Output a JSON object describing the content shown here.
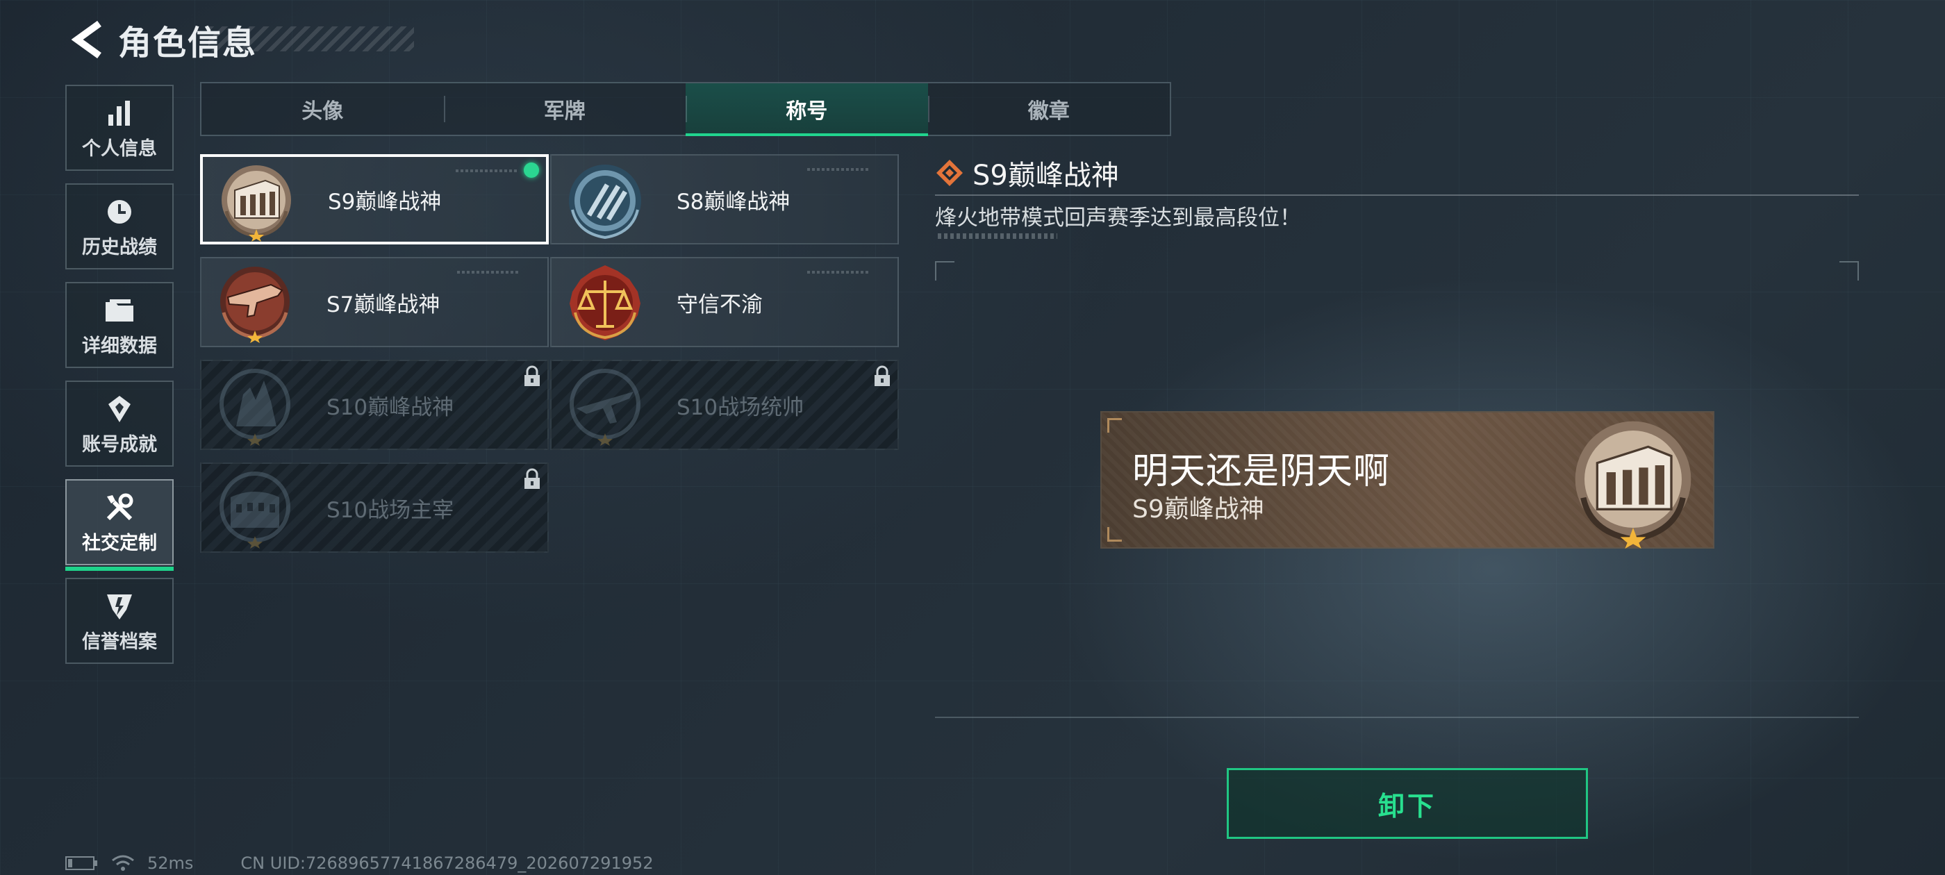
{
  "header": {
    "title": "角色信息"
  },
  "sidebar": {
    "items": [
      {
        "label": "个人信息",
        "icon": "bar-chart-icon"
      },
      {
        "label": "历史战绩",
        "icon": "history-icon"
      },
      {
        "label": "详细数据",
        "icon": "folder-icon"
      },
      {
        "label": "账号成就",
        "icon": "achievement-icon"
      },
      {
        "label": "社交定制",
        "icon": "tools-icon",
        "active": true
      },
      {
        "label": "信誉档案",
        "icon": "credit-shield-icon"
      }
    ]
  },
  "tabs": [
    {
      "label": "头像"
    },
    {
      "label": "军牌"
    },
    {
      "label": "称号",
      "active": true
    },
    {
      "label": "徽章"
    }
  ],
  "titles": [
    {
      "name": "S9巅峰战神",
      "state": "equipped-selected",
      "badge": "arch-bronze-badge-icon"
    },
    {
      "name": "S8巅峰战神",
      "state": "owned",
      "badge": "blue-stripe-badge-icon"
    },
    {
      "name": "S7巅峰战神",
      "state": "owned",
      "badge": "rifle-red-badge-icon"
    },
    {
      "name": "守信不渝",
      "state": "owned",
      "badge": "scales-badge-icon"
    },
    {
      "name": "S10巅峰战神",
      "state": "locked",
      "badge": "tower-badge-icon"
    },
    {
      "name": "S10战场统帅",
      "state": "locked",
      "badge": "aircraft-badge-icon"
    },
    {
      "name": "S10战场主宰",
      "state": "locked",
      "badge": "colosseum-badge-icon"
    }
  ],
  "detail": {
    "name": "S9巅峰战神",
    "description": "烽火地带模式回声赛季达到最高段位！"
  },
  "nameplate": {
    "player": "明天还是阴天啊",
    "title": "S9巅峰战神"
  },
  "actions": {
    "unequip": "卸下"
  },
  "status": {
    "ping": "52ms",
    "uid": "CN UID:7268965774186728647​9_202607291952"
  },
  "colors": {
    "accent": "#21d48e",
    "equipped_dot": "#2bd691",
    "nameplate": "#6b5543"
  }
}
